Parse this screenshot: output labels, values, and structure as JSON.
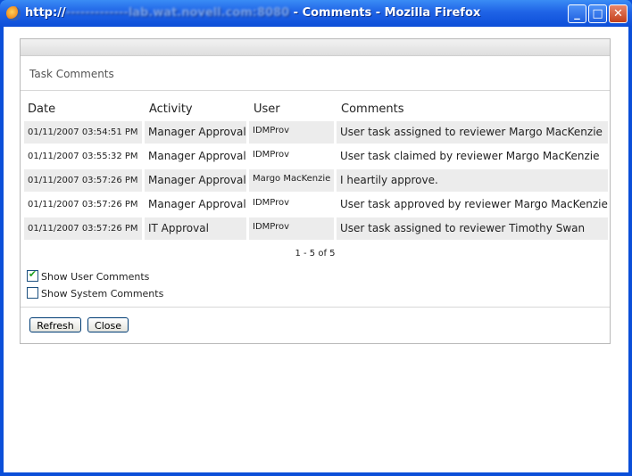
{
  "window": {
    "title_prefix": "http://",
    "title_obscured": "-------------lab.wat.novell.com:8080",
    "title_suffix": " - Comments - Mozilla Firefox",
    "min_glyph": "_",
    "max_glyph": "□",
    "close_glyph": "✕"
  },
  "panel": {
    "title": "Task Comments",
    "columns": [
      "Date",
      "Activity",
      "User",
      "Comments"
    ],
    "rows": [
      {
        "date": "01/11/2007 03:54:51 PM",
        "activity": "Manager Approval",
        "user": "IDMProv",
        "comment": "User task assigned to reviewer Margo MacKenzie"
      },
      {
        "date": "01/11/2007 03:55:32 PM",
        "activity": "Manager Approval",
        "user": "IDMProv",
        "comment": "User task claimed by reviewer Margo MacKenzie"
      },
      {
        "date": "01/11/2007 03:57:26 PM",
        "activity": "Manager Approval",
        "user": "Margo MacKenzie",
        "comment": "I heartily approve."
      },
      {
        "date": "01/11/2007 03:57:26 PM",
        "activity": "Manager Approval",
        "user": "IDMProv",
        "comment": "User task approved by reviewer Margo MacKenzie"
      },
      {
        "date": "01/11/2007 03:57:26 PM",
        "activity": "IT Approval",
        "user": "IDMProv",
        "comment": "User task assigned to reviewer Timothy Swan"
      }
    ],
    "pager": "1 - 5 of 5",
    "show_user_comments": {
      "label": "Show User Comments",
      "checked": true
    },
    "show_system_comments": {
      "label": "Show System Comments",
      "checked": false
    },
    "refresh_label": "Refresh",
    "close_label": "Close"
  }
}
